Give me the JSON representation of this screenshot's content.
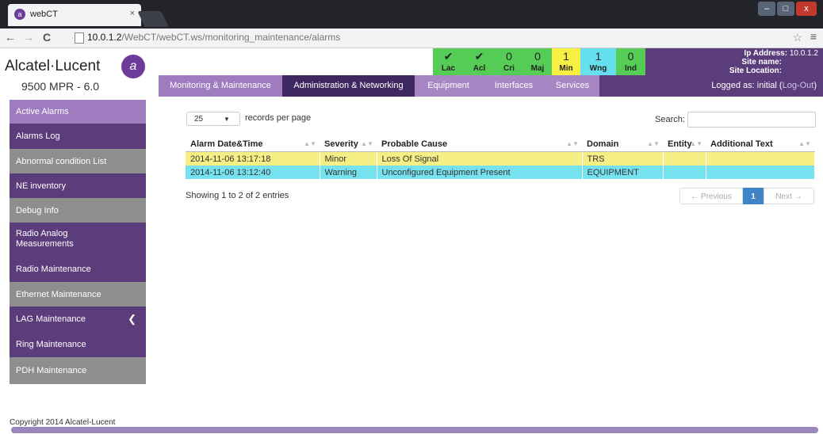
{
  "browser": {
    "tab_title": "webCT",
    "tab_close": "×",
    "url_host": "10.0.1.2",
    "url_path": "/WebCT/webCT.ws/monitoring_maintenance/alarms",
    "back": "←",
    "forward": "→",
    "reload": "C",
    "star": "☆",
    "menu": "≡"
  },
  "header": {
    "brand": "Alcatel·Lucent",
    "product": "9500 MPR - 6.0",
    "alarm_tiles": [
      {
        "value": "✔",
        "label": "Lac",
        "color": "#55cc55"
      },
      {
        "value": "✔",
        "label": "Acl",
        "color": "#55cc55"
      },
      {
        "value": "0",
        "label": "Cri",
        "color": "#55cc55"
      },
      {
        "value": "0",
        "label": "Maj",
        "color": "#55cc55"
      },
      {
        "value": "1",
        "label": "Min",
        "color": "#f7f043"
      },
      {
        "value": "1",
        "label": "Wng",
        "color": "#66e0ee"
      },
      {
        "value": "0",
        "label": "Ind",
        "color": "#55cc55"
      }
    ],
    "site": {
      "ip_label": "Ip Address:",
      "ip_value": "10.0.1.2",
      "name_label": "Site name:",
      "location_label": "Site Location:"
    }
  },
  "menu": {
    "items": [
      "Monitoring & Maintenance",
      "Administration & Networking",
      "Equipment",
      "Interfaces",
      "Services"
    ],
    "logged_prefix": "Logged as: initial (",
    "logout": "Log-Out",
    "logged_suffix": ")"
  },
  "sidebar": {
    "items": [
      "Active Alarms",
      "Alarms Log",
      "Abnormal condition List",
      "NE inventory",
      "Debug Info",
      "Radio Analog Measurements",
      "Radio Maintenance",
      "Ethernet Maintenance",
      "LAG Maintenance",
      "Ring Maintenance",
      "PDH Maintenance"
    ],
    "lag_chevron": "❮"
  },
  "table": {
    "page_size": "25",
    "records_per_page": "records per page",
    "search_label": "Search:",
    "columns": [
      "Alarm Date&Time",
      "Severity",
      "Probable Cause",
      "Domain",
      "Entity",
      "Additional Text"
    ],
    "rows": [
      {
        "date": "2014-11-06 13:17:18",
        "severity": "Minor",
        "cause": "Loss Of Signal",
        "domain": "TRS",
        "entity": "",
        "additional": "",
        "color": "#f5ef85"
      },
      {
        "date": "2014-11-06 13:12:40",
        "severity": "Warning",
        "cause": "Unconfigured Equipment Present",
        "domain": "EQUIPMENT",
        "entity": "",
        "additional": "",
        "color": "#76e2ef"
      }
    ],
    "info": "Showing 1 to 2 of 2 entries",
    "pagination": {
      "previous": "← Previous",
      "current": "1",
      "next": "Next →"
    }
  },
  "footer": {
    "copyright": "Copyright 2014 Alcatel-Lucent"
  }
}
